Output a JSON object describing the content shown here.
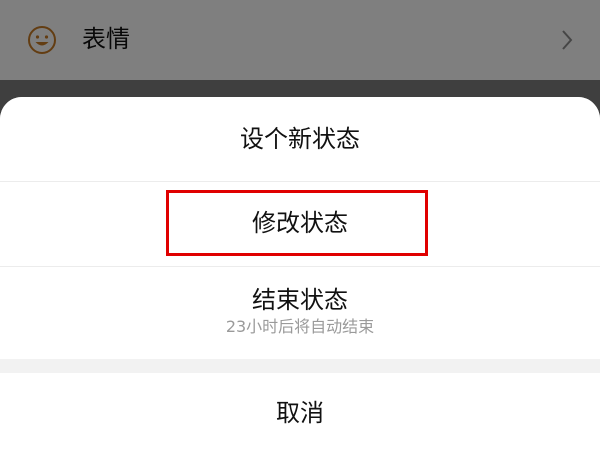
{
  "background_row": {
    "icon": "smiley-face-icon",
    "label": "表情",
    "chevron": "chevron-right-icon"
  },
  "action_sheet": {
    "set_new_status": "设个新状态",
    "edit_status": "修改状态",
    "end_status": {
      "label": "结束状态",
      "subtitle": "23小时后将自动结束"
    },
    "cancel": "取消"
  },
  "colors": {
    "highlight": "#e00000",
    "emoji_icon": "#c77a25",
    "subtitle_text": "#9a9a9a"
  }
}
